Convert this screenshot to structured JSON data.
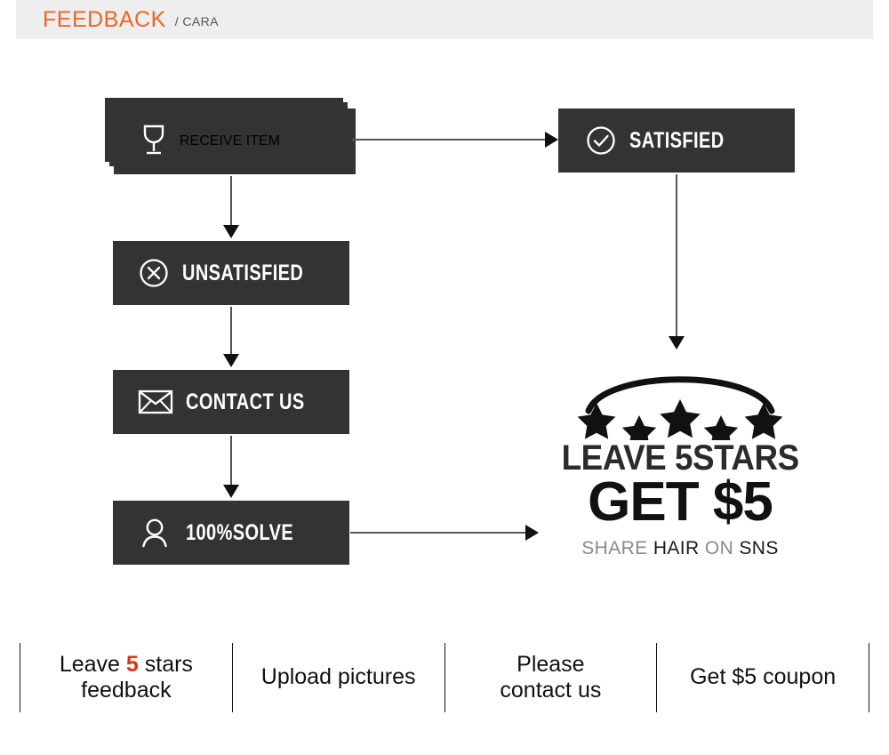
{
  "header": {
    "title": "FEEDBACK",
    "subtitle": "/ CARA",
    "accent_color": "#ee6622",
    "bg_color": "#eeeeee"
  },
  "flow": {
    "box_color": "#333333",
    "text_color": "#ffffff",
    "nodes": [
      {
        "id": "receive-item",
        "label": "RECEIVE ITEM",
        "icon": "wine-glass-icon",
        "stacked": true
      },
      {
        "id": "satisfied",
        "label": "SATISFIED",
        "icon": "check-circle-icon",
        "stacked": false
      },
      {
        "id": "unsatisfied",
        "label": "UNSATISFIED",
        "icon": "x-circle-icon",
        "stacked": false
      },
      {
        "id": "contact-us",
        "label": "CONTACT US",
        "icon": "envelope-icon",
        "stacked": false
      },
      {
        "id": "solve",
        "label": "100%SOLVE",
        "icon": "person-icon",
        "stacked": false
      }
    ],
    "connectors": [
      {
        "id": "receive-to-satisfied",
        "direction": "right"
      },
      {
        "id": "receive-to-unsatisfied",
        "direction": "down"
      },
      {
        "id": "unsatisfied-to-contact",
        "direction": "down"
      },
      {
        "id": "contact-to-solve",
        "direction": "down"
      },
      {
        "id": "satisfied-to-promo",
        "direction": "down"
      },
      {
        "id": "solve-to-promo",
        "direction": "right"
      }
    ]
  },
  "promo": {
    "stars_icon": "five-stars-arc-icon",
    "star_count": 5,
    "line1": "LEAVE 5STARS",
    "line2": "GET $5",
    "line3_part1": "SHARE ",
    "line3_part2": "HAIR",
    "line3_part3": " ON ",
    "line3_part4": "SNS"
  },
  "bottom_bar": {
    "items": [
      {
        "id": "leave-5-stars-feedback",
        "pre": "Leave ",
        "highlight": "5",
        "post": " stars",
        "line2": "feedback"
      },
      {
        "id": "upload-pictures",
        "pre": "Upload pictures",
        "highlight": "",
        "post": "",
        "line2": ""
      },
      {
        "id": "please-contact-us",
        "pre": "Please",
        "highlight": "",
        "post": "",
        "line2": "contact us"
      },
      {
        "id": "get-5-coupon",
        "pre": "Get $5 coupon",
        "highlight": "",
        "post": "",
        "line2": ""
      }
    ],
    "highlight_color": "#dd3311"
  }
}
